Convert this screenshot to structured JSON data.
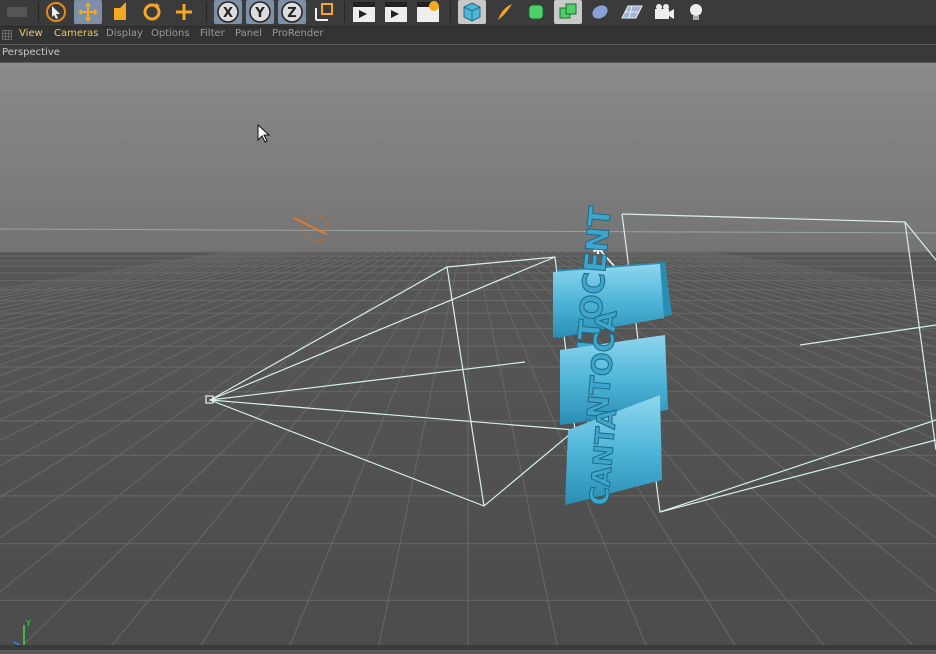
{
  "menubar": {
    "items": [
      "View",
      "Cameras",
      "Display",
      "Options",
      "Filter",
      "Panel",
      "ProRender"
    ]
  },
  "viewport": {
    "title": "Perspective",
    "text_object": {
      "lines": [
        "CENTOCENT",
        "CENTOCA",
        "CANTA"
      ]
    }
  },
  "toolbar": {
    "icons": [
      "select-arrow-icon",
      "move-icon",
      "scale-icon",
      "rotate-icon",
      "live-selection-icon",
      "x-axis-icon",
      "y-axis-icon",
      "z-axis-icon",
      "coordinate-system-icon",
      "render-view-icon",
      "render-picture-viewer-icon",
      "render-settings-icon",
      "cube-icon",
      "pen-icon",
      "subdivision-icon",
      "generator-icon",
      "deformer-icon",
      "floor-icon",
      "camera-icon",
      "light-icon"
    ],
    "axis_letters": [
      "X",
      "Y",
      "Z"
    ]
  },
  "colors": {
    "accent_yellow": "#e6c96a",
    "text_object_blue": "#4fb6d8",
    "frustum_lines": "#d6f0ec",
    "grid_line": "#6a6a6a"
  }
}
